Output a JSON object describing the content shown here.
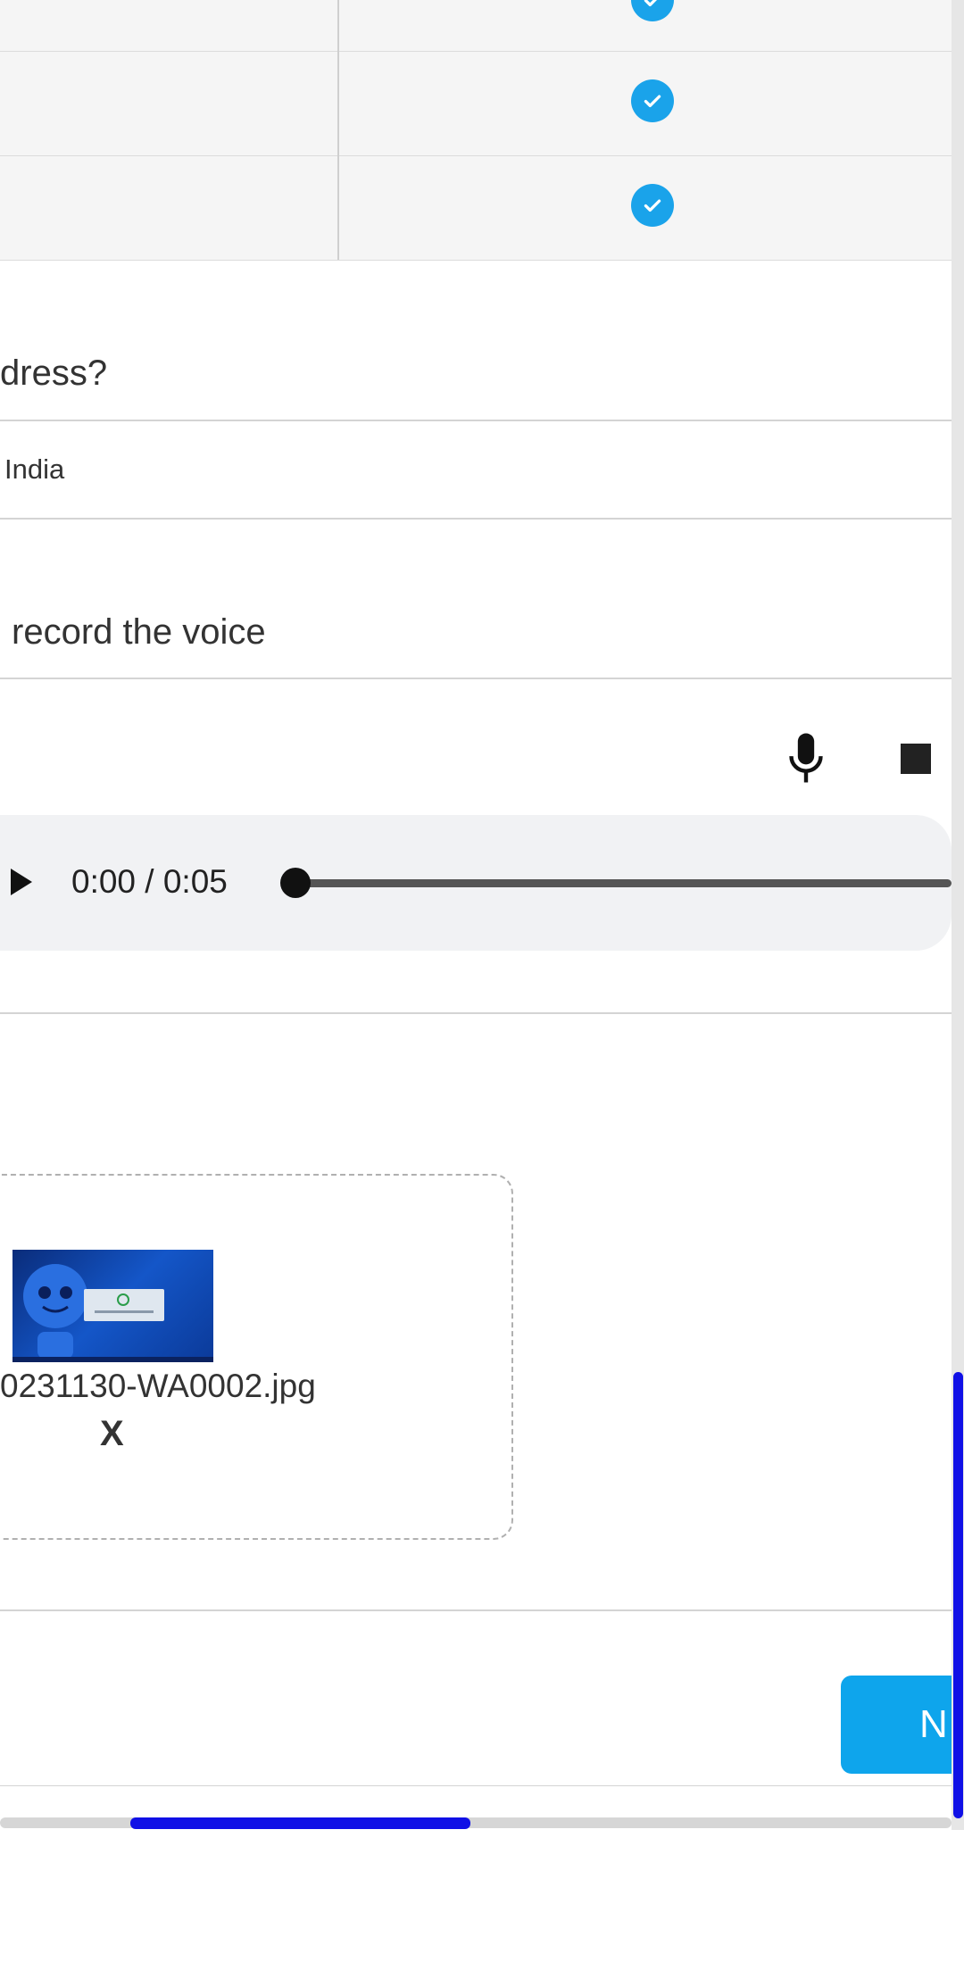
{
  "table": {
    "rows": [
      {
        "checked": true
      },
      {
        "checked": true
      },
      {
        "checked": true
      }
    ]
  },
  "address_question": {
    "label": "dress?",
    "answer": "India"
  },
  "voice_question": {
    "label": "record the voice"
  },
  "audio_player": {
    "time": "0:00 / 0:05",
    "progress": 0
  },
  "upload": {
    "file_name": "0231130-WA0002.jpg",
    "remove_label": "X"
  },
  "footer": {
    "next_label": "N"
  },
  "colors": {
    "accent": "#1aa3ea",
    "button": "#0ea5ec",
    "scrollbar": "#1010e6"
  },
  "icons": {
    "check": "check-circle-icon",
    "mic": "microphone-icon",
    "stop": "stop-icon",
    "play": "play-icon"
  }
}
